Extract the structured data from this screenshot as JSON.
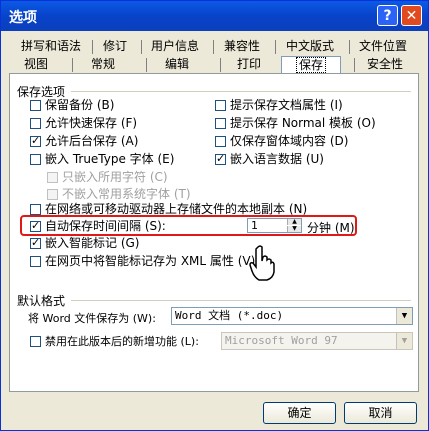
{
  "window": {
    "title": "选项",
    "help_glyph": "?",
    "close_glyph": "✕"
  },
  "tabs_row1": [
    "拼写和语法",
    "修订",
    "用户信息",
    "兼容性",
    "中文版式",
    "文件位置"
  ],
  "tabs_row2": [
    "视图",
    "常规",
    "编辑",
    "打印",
    "保存",
    "安全性"
  ],
  "active_tab": "保存",
  "save_options": {
    "label": "保存选项",
    "left": [
      {
        "label": "保留备份 (B)",
        "checked": false,
        "enabled": true
      },
      {
        "label": "允许快速保存 (F)",
        "checked": false,
        "enabled": true
      },
      {
        "label": "允许后台保存 (A)",
        "checked": true,
        "enabled": true
      },
      {
        "label": "嵌入 TrueType 字体 (E)",
        "checked": false,
        "enabled": true
      },
      {
        "label": "只嵌入所用字符 (C)",
        "checked": false,
        "enabled": false
      },
      {
        "label": "不嵌入常用系统字体 (T)",
        "checked": false,
        "enabled": false
      }
    ],
    "right": [
      {
        "label": "提示保存文档属性 (I)",
        "checked": false,
        "enabled": true
      },
      {
        "label": "提示保存 Normal 模板 (O)",
        "checked": false,
        "enabled": true
      },
      {
        "label": "仅保存窗体域内容 (D)",
        "checked": false,
        "enabled": true
      },
      {
        "label": "嵌入语言数据 (U)",
        "checked": true,
        "enabled": true
      }
    ],
    "network_copy": {
      "label": "在网络或可移动驱动器上存储文件的本地副本 (N)",
      "checked": false
    },
    "autosave": {
      "label": "自动保存时间间隔 (S):",
      "checked": true,
      "value": "1",
      "unit": "分钟 (M)"
    },
    "smart_tags": {
      "label": "嵌入智能标记 (G)",
      "checked": true
    },
    "xml_tags": {
      "label": "在网页中将智能标记存为 XML 属性 (V)",
      "checked": false
    }
  },
  "default_format": {
    "label": "默认格式",
    "save_as_label": "将 Word 文件保存为 (W):",
    "save_as_value": "Word 文档 (*.doc)",
    "disable_features": {
      "label": "禁用在此版本后的新增功能 (L):",
      "checked": false
    },
    "version_value": "Microsoft Word 97"
  },
  "buttons": {
    "ok": "确定",
    "cancel": "取消"
  }
}
